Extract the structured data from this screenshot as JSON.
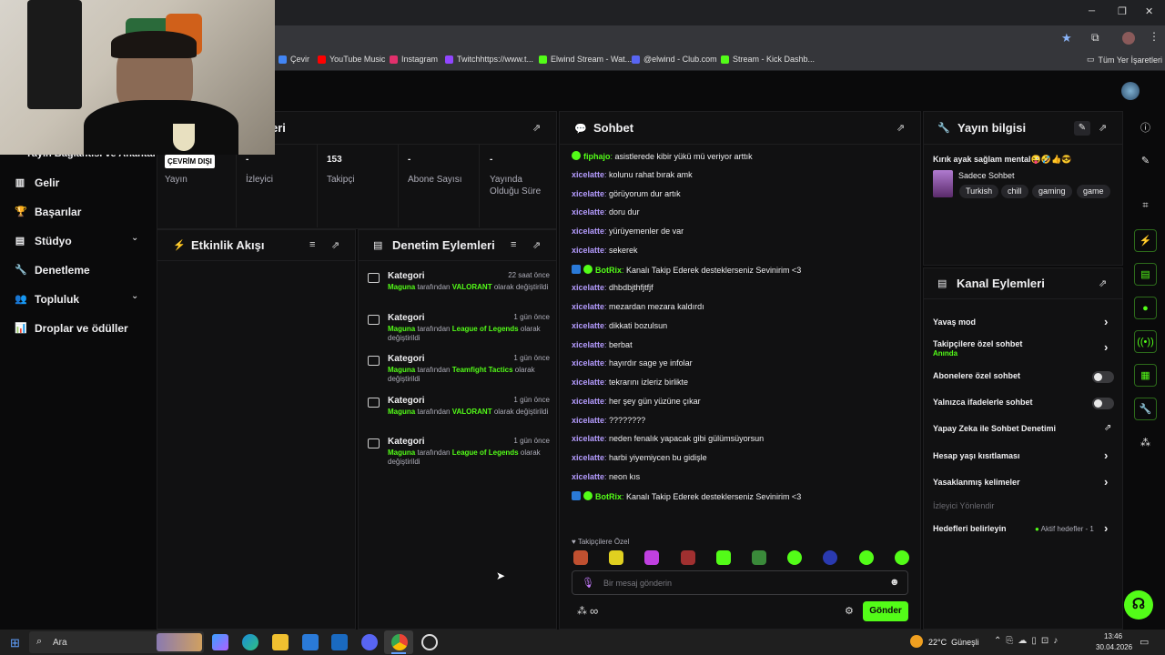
{
  "window": {
    "minimize": "─",
    "maximize": "❐",
    "close": "✕"
  },
  "addressbar": {
    "star": "★",
    "ext": "⧉"
  },
  "bookmarks": [
    {
      "label": "Çevir",
      "color": "#4285f4"
    },
    {
      "label": "YouTube Music",
      "color": "#ff0000"
    },
    {
      "label": "Instagram",
      "color": "#e1306c"
    },
    {
      "label": "Twitchhttps://www.t...",
      "color": "#9146ff"
    },
    {
      "label": "Elwind Stream - Wat...",
      "color": "#53fc18"
    },
    {
      "label": "@elwind - Club.com",
      "color": "#5865f2"
    },
    {
      "label": "Stream - Kick Dashb...",
      "color": "#53fc18"
    }
  ],
  "all_bookmarks": "Tüm Yer İşaretleri",
  "sidebar": {
    "partial_label": "Yayın Bağlantısı ve Anahtarı",
    "items": [
      {
        "label": "Gelir",
        "icon": "▥"
      },
      {
        "label": "Başarılar",
        "icon": "🏆"
      },
      {
        "label": "Stüdyo",
        "icon": "▤",
        "chevron": "⌄"
      },
      {
        "label": "Denetleme",
        "icon": "🔧"
      },
      {
        "label": "Topluluk",
        "icon": "👥",
        "chevron": "⌄"
      },
      {
        "label": "Droplar ve ödüller",
        "icon": "📊"
      }
    ]
  },
  "stats_panel": {
    "title_partial": "eri",
    "offline_badge": "ÇEVRİM DIŞI",
    "stats": [
      {
        "label": "Yayın",
        "value": ""
      },
      {
        "label": "İzleyici",
        "value": "-"
      },
      {
        "label": "Takipçi",
        "value": "153"
      },
      {
        "label": "Abone Sayısı",
        "value": "-"
      },
      {
        "label": "Yayında\nOlduğu Süre",
        "value": "-"
      }
    ]
  },
  "activity_panel": {
    "title": "Etkinlik Akışı"
  },
  "moderation_panel": {
    "title": "Denetim Eylemleri",
    "rows": [
      {
        "kind": "Kategori",
        "time": "22 saat önce",
        "user": "Maguna",
        "middle": "tarafından",
        "category": "VALORANT",
        "tail": "olarak değiştirildi"
      },
      {
        "kind": "Kategori",
        "time": "1 gün önce",
        "user": "Maguna",
        "middle": "tarafından",
        "category": "League of Legends",
        "tail": "olarak değiştirildi"
      },
      {
        "kind": "Kategori",
        "time": "1 gün önce",
        "user": "Maguna",
        "middle": "tarafından",
        "category": "Teamfight Tactics",
        "tail": "olarak değiştirildi"
      },
      {
        "kind": "Kategori",
        "time": "1 gün önce",
        "user": "Maguna",
        "middle": "tarafından",
        "category": "VALORANT",
        "tail": "olarak değiştirildi"
      },
      {
        "kind": "Kategori",
        "time": "1 gün önce",
        "user": "Maguna",
        "middle": "tarafından",
        "category": "League of Legends",
        "tail": "olarak değiştirildi"
      }
    ]
  },
  "chat": {
    "title": "Sohbet",
    "messages": [
      {
        "user": "fiphajo",
        "text": "asistlerede kibir yükü mü veriyor arttık",
        "badges": [
          "green"
        ],
        "green": true
      },
      {
        "user": "xicelatte",
        "text": "kolunu rahat bırak amk"
      },
      {
        "user": "xicelatte",
        "text": "görüyorum dur artık"
      },
      {
        "user": "xicelatte",
        "text": "doru dur"
      },
      {
        "user": "xicelatte",
        "text": "yürüyemenler de var"
      },
      {
        "user": "xicelatte",
        "text": "sekerek"
      },
      {
        "user": "BotRix",
        "text": "Kanalı Takip Ederek desteklerseniz Sevinirim <3",
        "badges": [
          "blue",
          "green"
        ],
        "green": true
      },
      {
        "user": "xicelatte",
        "text": "dhbdbjthfjtfjf"
      },
      {
        "user": "xicelatte",
        "text": "mezardan mezara kaldırdı"
      },
      {
        "user": "xicelatte",
        "text": "dikkati bozulsun"
      },
      {
        "user": "xicelatte",
        "text": "berbat"
      },
      {
        "user": "xicelatte",
        "text": "hayırdır sage ye infolar"
      },
      {
        "user": "xicelatte",
        "text": "tekrarını izleriz birlikte"
      },
      {
        "user": "xicelatte",
        "text": "her şey gün yüzüne çıkar"
      },
      {
        "user": "xicelatte",
        "text": "????????"
      },
      {
        "user": "xicelatte",
        "text": "neden fenalık yapacak gibi gülümsüyorsun"
      },
      {
        "user": "xicelatte",
        "text": "harbi yiyemiycen bu gidişle"
      },
      {
        "user": "xicelatte",
        "text": "neon kıs"
      },
      {
        "user": "BotRix",
        "text": "Kanalı Takip Ederek desteklerseniz Sevinirim <3",
        "badges": [
          "blue",
          "green"
        ],
        "green": true
      }
    ],
    "followers_only": "Takipçilere Özel",
    "placeholder": "Bir mesaj gönderin",
    "send": "Gönder",
    "infinity": "∞"
  },
  "stream_info": {
    "title": "Yayın bilgisi",
    "stream_title": "Kırık ayak sağlam mental😜🤣👍😎",
    "category": "Sadece Sohbet",
    "tags": [
      "Turkish",
      "chill",
      "gaming",
      "game"
    ]
  },
  "channel_actions": {
    "title": "Kanal Eylemleri",
    "items": [
      {
        "label": "Yavaş mod",
        "control": "chevron"
      },
      {
        "label": "Takipçilere özel sohbet",
        "sub": "Anında",
        "control": "chevron"
      },
      {
        "label": "Abonelere özel sohbet",
        "control": "toggle",
        "on": false
      },
      {
        "label": "Yalnızca ifadelerle sohbet",
        "control": "toggle",
        "on": false
      },
      {
        "label": "Yapay Zeka ile Sohbet Denetimi",
        "control": "external"
      },
      {
        "label": "Hesap yaşı kısıtlaması",
        "control": "chevron"
      },
      {
        "label": "Yasaklanmış kelimeler",
        "control": "chevron"
      },
      {
        "label": "İzleyici Yönlendir",
        "control": "none",
        "muted": true
      },
      {
        "label": "Hedefleri belirleyin",
        "control": "chevron",
        "status": "Aktif hedefler - 1"
      }
    ]
  },
  "taskbar": {
    "search": "Ara",
    "weather": "22°C  Güneşli",
    "time": "13:46",
    "date": "30.04.2026"
  },
  "colors": {
    "accent": "#53fc18",
    "username": "#b59cff",
    "bg": "#0a0a0b",
    "panel": "#111112"
  }
}
